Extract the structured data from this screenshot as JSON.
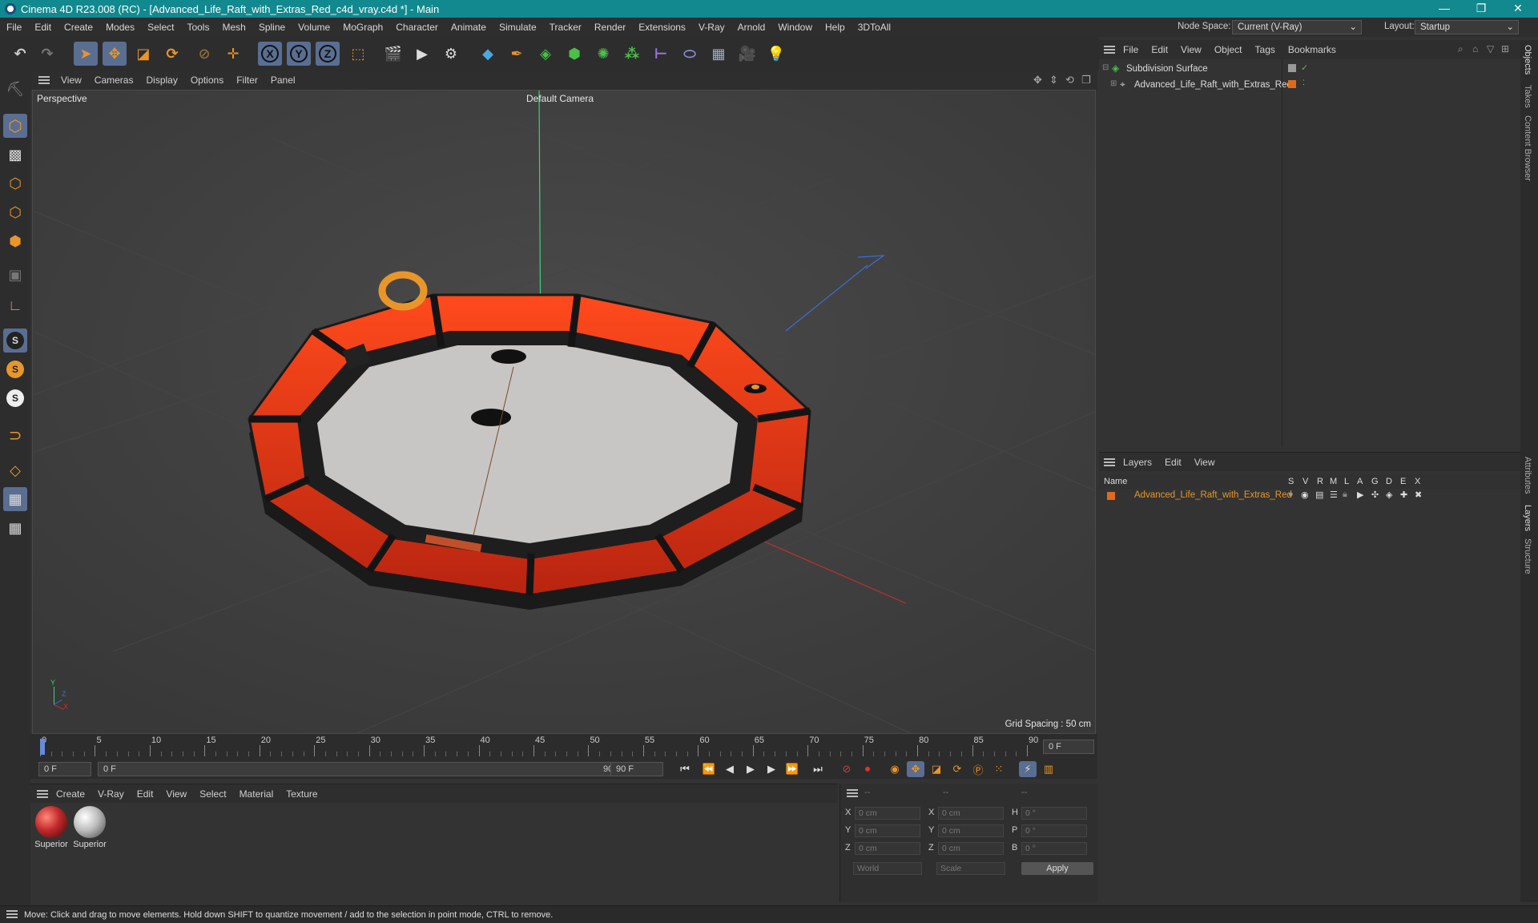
{
  "window": {
    "title": "Cinema 4D R23.008 (RC) - [Advanced_Life_Raft_with_Extras_Red_c4d_vray.c4d *] - Main",
    "minimize": "—",
    "restore": "❐",
    "close": "✕"
  },
  "menubar": {
    "items": [
      "File",
      "Edit",
      "Create",
      "Modes",
      "Select",
      "Tools",
      "Mesh",
      "Spline",
      "Volume",
      "MoGraph",
      "Character",
      "Animate",
      "Simulate",
      "Tracker",
      "Render",
      "Extensions",
      "V-Ray",
      "Arnold",
      "Window",
      "Help",
      "3DToAll"
    ],
    "node_space_label": "Node Space:",
    "node_space_value": "Current (V-Ray)",
    "layout_label": "Layout:",
    "layout_value": "Startup"
  },
  "toolbar": {
    "axis_x": "X",
    "axis_y": "Y",
    "axis_z": "Z"
  },
  "viewport": {
    "menu": [
      "View",
      "Cameras",
      "Display",
      "Options",
      "Filter",
      "Panel"
    ],
    "view_name": "Perspective",
    "camera": "Default Camera",
    "grid_spacing": "Grid Spacing : 50 cm",
    "axis_y": "Y",
    "axis_z": "Z",
    "axis_x": "X"
  },
  "timeline": {
    "ticks": [
      "0",
      "5",
      "10",
      "15",
      "20",
      "25",
      "30",
      "35",
      "40",
      "45",
      "50",
      "55",
      "60",
      "65",
      "70",
      "75",
      "80",
      "85",
      "90"
    ],
    "current_frame": "0 F"
  },
  "transport": {
    "start": "0 F",
    "range_start": "0 F",
    "range_end": "90 F",
    "end": "90 F"
  },
  "material_menu": [
    "Create",
    "V-Ray",
    "Edit",
    "View",
    "Select",
    "Material",
    "Texture"
  ],
  "materials": [
    {
      "name": "Superior",
      "color": "#c0292b"
    },
    {
      "name": "Superior",
      "color": "#bdbdbd"
    }
  ],
  "coords": {
    "head": [
      "--",
      "--",
      "--"
    ],
    "labels1": [
      "X",
      "Y",
      "Z"
    ],
    "labels2": [
      "X",
      "Y",
      "Z"
    ],
    "labels3": [
      "H",
      "P",
      "B"
    ],
    "values1": [
      "0 cm",
      "0 cm",
      "0 cm"
    ],
    "values2": [
      "0 cm",
      "0 cm",
      "0 cm"
    ],
    "values3": [
      "0 °",
      "0 °",
      "0 °"
    ],
    "world": "World",
    "scale": "Scale",
    "apply": "Apply"
  },
  "objects": {
    "menu": [
      "File",
      "Edit",
      "View",
      "Object",
      "Tags",
      "Bookmarks"
    ],
    "items": [
      {
        "name": "Subdivision Surface"
      },
      {
        "name": "Advanced_Life_Raft_with_Extras_Red"
      }
    ]
  },
  "layers": {
    "menu": [
      "Layers",
      "Edit",
      "View"
    ],
    "columns": [
      "Name",
      "S",
      "V",
      "R",
      "M",
      "L",
      "A",
      "G",
      "D",
      "E",
      "X"
    ],
    "items": [
      {
        "name": "Advanced_Life_Raft_with_Extras_Red",
        "color": "#e06a1a"
      }
    ]
  },
  "side_tabs": [
    "Objects",
    "Takes",
    "Content Browser",
    "Attributes",
    "Layers",
    "Structure"
  ],
  "status": "Move: Click and drag to move elements. Hold down SHIFT to quantize movement / add to the selection in point mode, CTRL to remove.",
  "colors": {
    "title_bar": "#12898e",
    "accent_orange": "#e8962a",
    "raft_red": "#d4361a"
  }
}
